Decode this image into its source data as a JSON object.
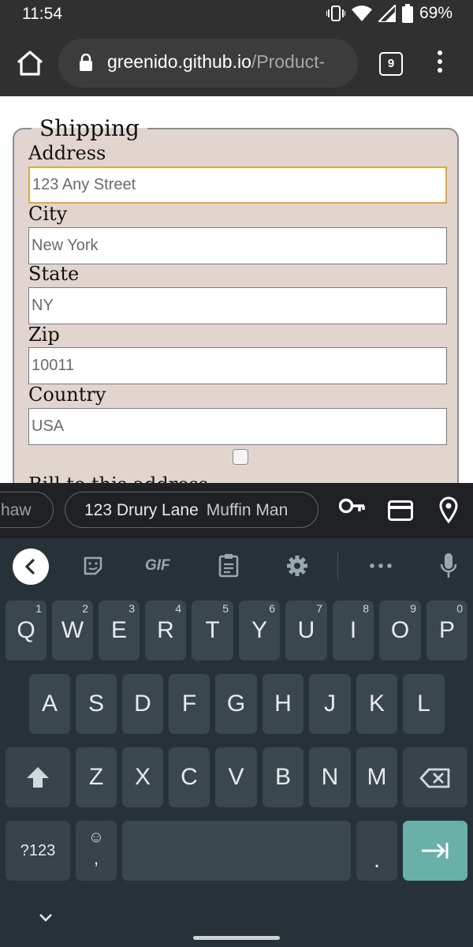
{
  "status_bar": {
    "time": "11:54",
    "battery": "69%"
  },
  "browser": {
    "url_domain": "greenido.github.io",
    "url_path": "/Product-",
    "tab_count": "9"
  },
  "form": {
    "legend": "Shipping",
    "fields": [
      {
        "label": "Address",
        "value": "123 Any Street"
      },
      {
        "label": "City",
        "value": "New York"
      },
      {
        "label": "State",
        "value": "NY"
      },
      {
        "label": "Zip",
        "value": "10011"
      },
      {
        "label": "Country",
        "value": "USA"
      }
    ],
    "bill_label": "Bill to this address"
  },
  "autofill": {
    "prev_suggestion": "haw",
    "suggestion_main": "123 Drury Lane",
    "suggestion_sub": "Muffin Man"
  },
  "keyboard": {
    "toolbar": {
      "gif": "GIF"
    },
    "row1": [
      {
        "key": "Q",
        "hint": "1"
      },
      {
        "key": "W",
        "hint": "2"
      },
      {
        "key": "E",
        "hint": "3"
      },
      {
        "key": "R",
        "hint": "4"
      },
      {
        "key": "T",
        "hint": "5"
      },
      {
        "key": "Y",
        "hint": "6"
      },
      {
        "key": "U",
        "hint": "7"
      },
      {
        "key": "I",
        "hint": "8"
      },
      {
        "key": "O",
        "hint": "9"
      },
      {
        "key": "P",
        "hint": "0"
      }
    ],
    "row2": [
      "A",
      "S",
      "D",
      "F",
      "G",
      "H",
      "J",
      "K",
      "L"
    ],
    "row3": [
      "Z",
      "X",
      "C",
      "V",
      "B",
      "N",
      "M"
    ],
    "bottom": {
      "symbols": "?123",
      "emoji": "☺",
      "comma": ",",
      "period": "."
    }
  }
}
